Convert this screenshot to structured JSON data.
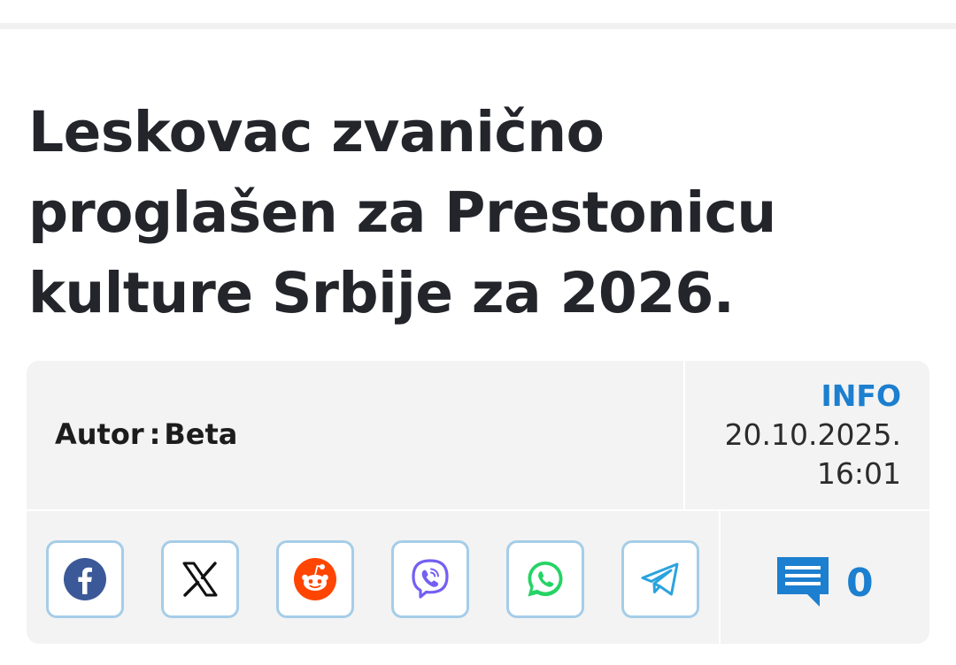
{
  "article": {
    "headline": "Leskovac zvanično proglašen za Prestonicu kulture Srbije za 2026."
  },
  "meta": {
    "author_label": "Autor",
    "author_sep": ":",
    "author_name": "Beta",
    "category": "INFO",
    "date": "20.10.2025.",
    "time": "16:01"
  },
  "share": {
    "buttons": [
      {
        "network": "Facebook",
        "icon": "facebook-icon",
        "color": "#3b5998"
      },
      {
        "network": "X",
        "icon": "x-icon",
        "color": "#000000"
      },
      {
        "network": "Reddit",
        "icon": "reddit-icon",
        "color": "#ff4500"
      },
      {
        "network": "Viber",
        "icon": "viber-icon",
        "color": "#7360f2"
      },
      {
        "network": "WhatsApp",
        "icon": "whatsapp-icon",
        "color": "#25d366"
      },
      {
        "network": "Telegram",
        "icon": "telegram-icon",
        "color": "#2aa3df"
      }
    ]
  },
  "comments": {
    "icon": "comment-icon",
    "count": "0"
  },
  "colors": {
    "accent": "#1c7fcf",
    "card_background": "#f3f3f3",
    "button_border": "#a5cde8",
    "text": "#23252b"
  }
}
